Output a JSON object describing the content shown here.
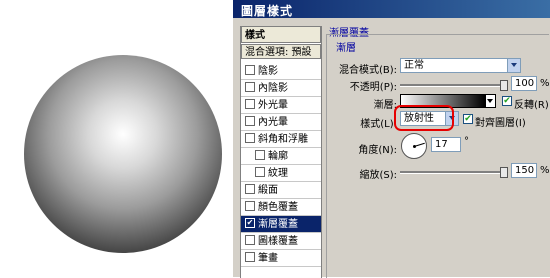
{
  "dialog": {
    "title": "圖層樣式"
  },
  "style_list": {
    "header": "樣式",
    "blend_options": "混合選項: 預設",
    "items": [
      {
        "label": "陰影",
        "checked": false,
        "sub": false,
        "active": false
      },
      {
        "label": "內陰影",
        "checked": false,
        "sub": false,
        "active": false
      },
      {
        "label": "外光暈",
        "checked": false,
        "sub": false,
        "active": false
      },
      {
        "label": "內光暈",
        "checked": false,
        "sub": false,
        "active": false
      },
      {
        "label": "斜角和浮雕",
        "checked": false,
        "sub": false,
        "active": false
      },
      {
        "label": "輪廓",
        "checked": false,
        "sub": true,
        "active": false
      },
      {
        "label": "紋理",
        "checked": false,
        "sub": true,
        "active": false
      },
      {
        "label": "緞面",
        "checked": false,
        "sub": false,
        "active": false
      },
      {
        "label": "顏色覆蓋",
        "checked": false,
        "sub": false,
        "active": false
      },
      {
        "label": "漸層覆蓋",
        "checked": true,
        "sub": false,
        "active": true
      },
      {
        "label": "圖樣覆蓋",
        "checked": false,
        "sub": false,
        "active": false
      },
      {
        "label": "筆畫",
        "checked": false,
        "sub": false,
        "active": false
      }
    ]
  },
  "gradient_overlay": {
    "panel_title": "漸層覆蓋",
    "group_title": "漸層",
    "blend_mode_label": "混合模式(B):",
    "blend_mode_value": "正常",
    "opacity_label": "不透明(P):",
    "opacity_value": "100",
    "opacity_unit": "%",
    "opacity_fraction": 1.0,
    "gradient_label": "漸層:",
    "reverse_label": "反轉(R)",
    "reverse_checked": true,
    "style_label": "樣式(L):",
    "style_value": "放射性",
    "align_label": "對齊圖層(I)",
    "align_checked": true,
    "angle_label": "角度(N):",
    "angle_value": "17",
    "angle_unit": "°",
    "scale_label": "縮放(S):",
    "scale_value": "150",
    "scale_unit": "%",
    "scale_fraction": 1.0
  }
}
